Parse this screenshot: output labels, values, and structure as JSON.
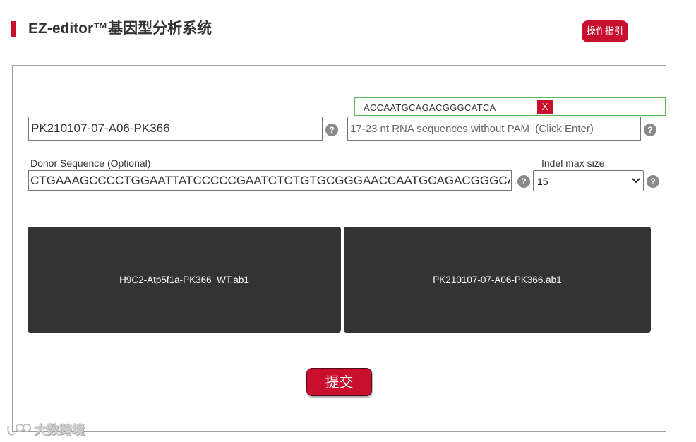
{
  "header": {
    "title": "EZ-editor™基因型分析系统",
    "guide_button": "操作指引"
  },
  "form": {
    "sample_name": {
      "value": "PK210107-07-A06-PK366"
    },
    "grna": {
      "placeholder": "17-23 nt RNA sequences without PAM  (Click Enter)",
      "tags": [
        {
          "text": "ACCAATGCAGACGGGCATCA",
          "remove_label": "X"
        }
      ]
    },
    "donor": {
      "label": "Donor Sequence (Optional)",
      "value": "CTGAAAGCCCCTGGAATTATCCCCCGAATCTCTGTGCGGGAACCAATGCAGACGGGCATCA"
    },
    "indel": {
      "label": "Indel max size:",
      "selected": "15"
    },
    "help_glyph": "?"
  },
  "uploads": {
    "wt_file": "H9C2-Atp5f1a-PK366_WT.ab1",
    "sample_file": "PK210107-07-A06-PK366.ab1"
  },
  "submit_label": "提交",
  "watermark": {
    "text": "大数跨境"
  },
  "colors": {
    "brand_red": "#c8102e",
    "upload_bg": "#333333",
    "tag_border": "#5cb85c",
    "help_bg": "#8a8a8a"
  }
}
